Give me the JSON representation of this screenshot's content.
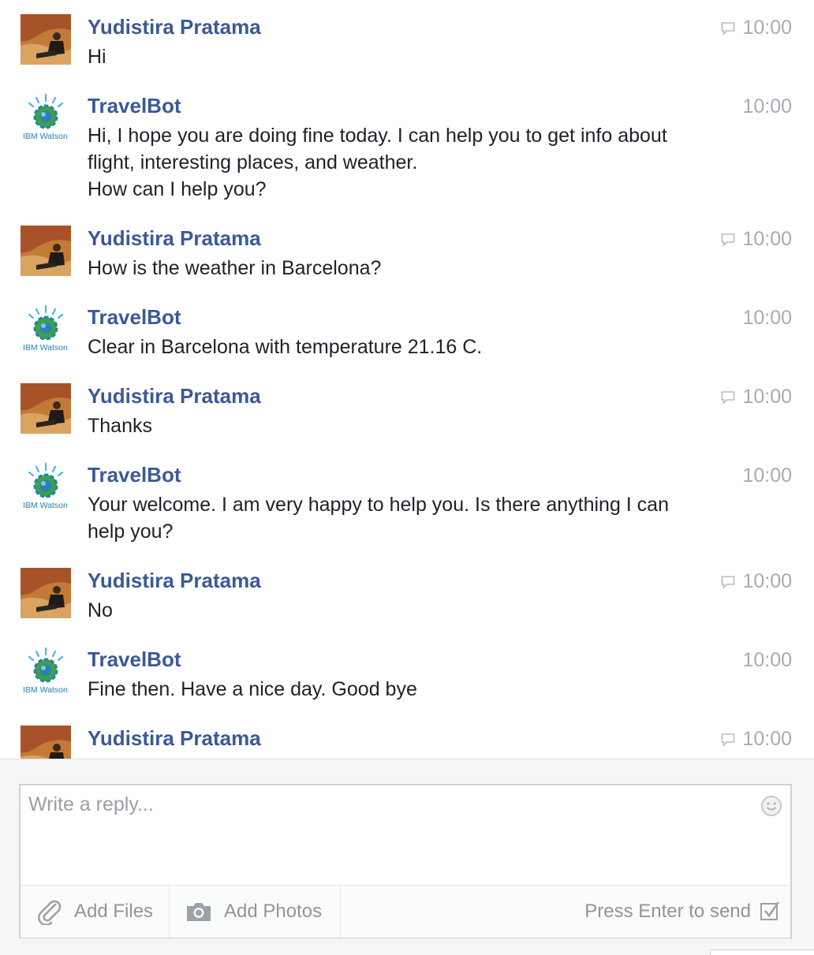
{
  "messages": [
    {
      "sender": "Yudistira Pratama",
      "type": "user",
      "lines": [
        "Hi"
      ],
      "time": "10:00"
    },
    {
      "sender": "TravelBot",
      "type": "bot",
      "lines": [
        "Hi, I hope you are doing fine today. I can help you to get info about",
        "flight, interesting places, and weather.",
        "How can I help you?"
      ],
      "time": "10:00"
    },
    {
      "sender": "Yudistira Pratama",
      "type": "user",
      "lines": [
        "How is the weather in Barcelona?"
      ],
      "time": "10:00"
    },
    {
      "sender": "TravelBot",
      "type": "bot",
      "lines": [
        "Clear in Barcelona with temperature 21.16 C."
      ],
      "time": "10:00"
    },
    {
      "sender": "Yudistira Pratama",
      "type": "user",
      "lines": [
        "Thanks"
      ],
      "time": "10:00"
    },
    {
      "sender": "TravelBot",
      "type": "bot",
      "lines": [
        "Your welcome. I am very happy to help you. Is there anything I can",
        "help you?"
      ],
      "time": "10:00"
    },
    {
      "sender": "Yudistira Pratama",
      "type": "user",
      "lines": [
        "No"
      ],
      "time": "10:00"
    },
    {
      "sender": "TravelBot",
      "type": "bot",
      "lines": [
        "Fine then. Have a nice day. Good bye"
      ],
      "time": "10:00"
    },
    {
      "sender": "Yudistira Pratama",
      "type": "user",
      "lines": [],
      "time": "10:00"
    }
  ],
  "bot_avatar_label": "IBM Watson",
  "composer": {
    "placeholder": "Write a reply...",
    "add_files": "Add Files",
    "add_photos": "Add Photos",
    "press_enter": "Press Enter to send"
  },
  "colors": {
    "sender": "#3b5998",
    "text": "#1d2129",
    "muted": "#a7abb3"
  }
}
